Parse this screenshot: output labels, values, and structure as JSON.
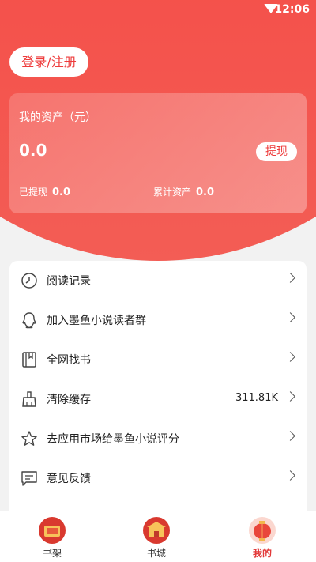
{
  "status_bar": {
    "time": "12:06"
  },
  "header": {
    "login_label": "登录/注册"
  },
  "assets": {
    "title": "我的资产（元）",
    "amount": "0.0",
    "withdraw_label": "提现",
    "withdrawn_label": "已提现",
    "withdrawn_value": "0.0",
    "total_label": "累计资产",
    "total_value": "0.0"
  },
  "menu": {
    "items": [
      {
        "label": "阅读记录",
        "icon": "clock-icon",
        "value": ""
      },
      {
        "label": "加入墨鱼小说读者群",
        "icon": "qq-icon",
        "value": ""
      },
      {
        "label": "全网找书",
        "icon": "book-icon",
        "value": ""
      },
      {
        "label": "清除缓存",
        "icon": "broom-icon",
        "value": "311.81K"
      },
      {
        "label": "去应用市场给墨鱼小说评分",
        "icon": "star-icon",
        "value": ""
      },
      {
        "label": "意见反馈",
        "icon": "feedback-icon",
        "value": ""
      }
    ]
  },
  "tabs": [
    {
      "label": "书架",
      "icon": "bookshelf-icon",
      "active": false
    },
    {
      "label": "书城",
      "icon": "bookstore-icon",
      "active": false
    },
    {
      "label": "我的",
      "icon": "lantern-icon",
      "active": true
    }
  ],
  "colors": {
    "brand": "#ee3b3b",
    "active_tab": "#e23a3a"
  }
}
